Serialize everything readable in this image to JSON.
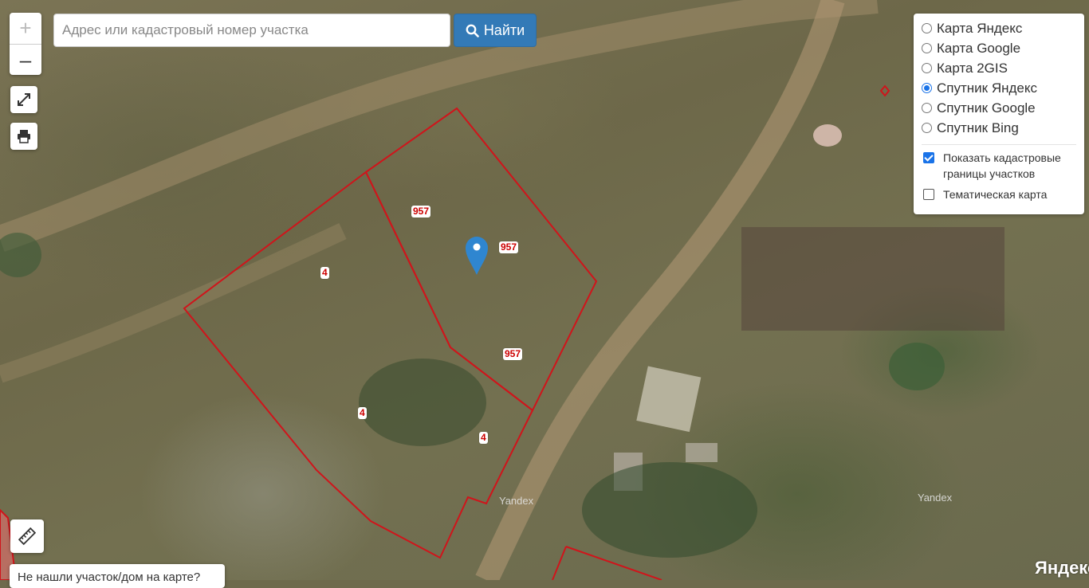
{
  "map": {
    "parcel_labels": [
      {
        "text": "957",
        "id": "label-957-a"
      },
      {
        "text": "957",
        "id": "label-957-b"
      },
      {
        "text": "957",
        "id": "label-957-c"
      },
      {
        "text": "4",
        "id": "label-4-a"
      },
      {
        "text": "4",
        "id": "label-4-b"
      },
      {
        "text": "4",
        "id": "label-4-c"
      }
    ],
    "watermarks": [
      "Yandex",
      "Yandex"
    ],
    "logo": "Яндекс",
    "boundary_color": "#d0141b",
    "marker_color": "#2f86d0"
  },
  "controls": {
    "zoom_in": "+",
    "zoom_out": "–",
    "fullscreen_icon": "expand-icon",
    "print_icon": "printer-icon",
    "ruler_icon": "ruler-icon"
  },
  "search": {
    "placeholder": "Адрес или кадастровый номер участка",
    "value": "",
    "button_label": "Найти",
    "button_icon": "search-icon",
    "button_color": "#337ab7"
  },
  "layers": {
    "options": [
      {
        "label": "Карта Яндекс",
        "selected": false
      },
      {
        "label": "Карта Google",
        "selected": false
      },
      {
        "label": "Карта 2GIS",
        "selected": false
      },
      {
        "label": "Спутник Яндекс",
        "selected": true
      },
      {
        "label": "Спутник Google",
        "selected": false
      },
      {
        "label": "Спутник Bing",
        "selected": false
      }
    ],
    "checkboxes": [
      {
        "label": "Показать кадастровые границы участков",
        "checked": true
      },
      {
        "label": "Тематическая карта",
        "checked": false
      }
    ]
  },
  "footer": {
    "not_found": "Не нашли участок/дом на карте?"
  }
}
